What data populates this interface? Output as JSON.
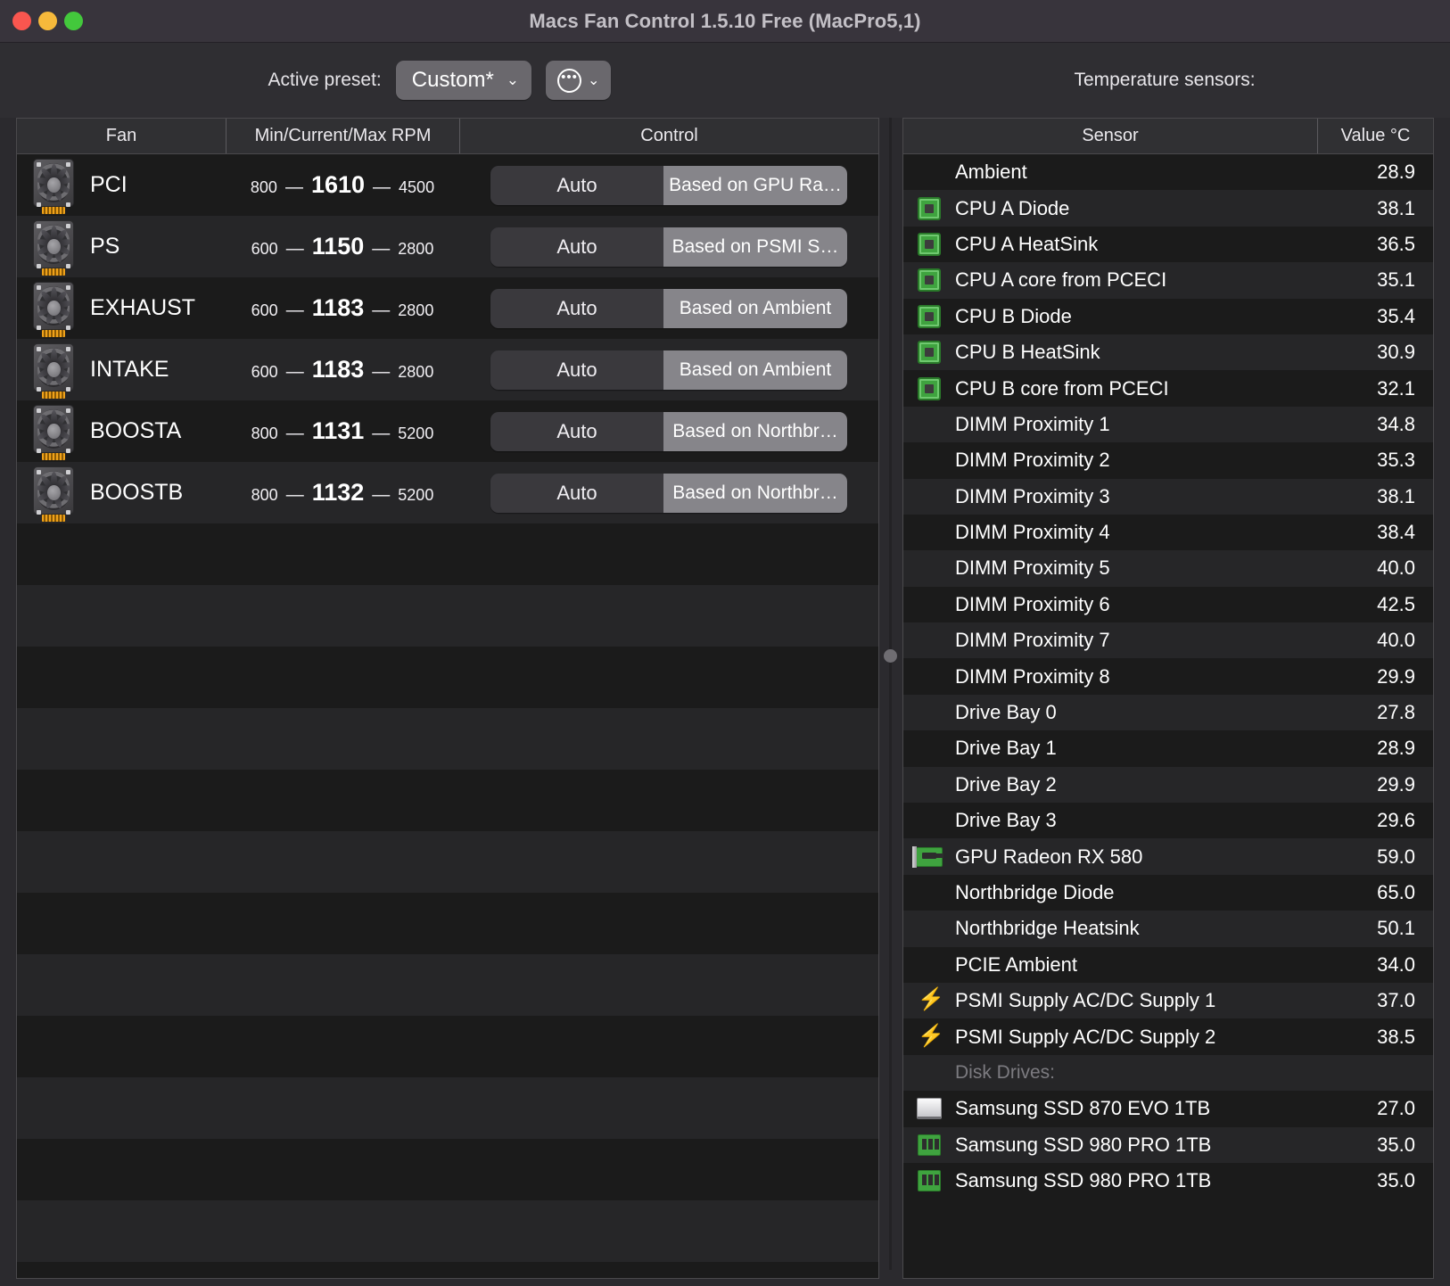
{
  "window": {
    "title": "Macs Fan Control 1.5.10 Free (MacPro5,1)",
    "traffic_lights": [
      "close-button",
      "minimize-button",
      "zoom-button"
    ]
  },
  "toolbar": {
    "preset_label": "Active preset:",
    "preset_value": "Custom*",
    "preset_chevron": "⌄",
    "menu_dots": "•••",
    "menu_chevron": "⌄",
    "sensors_title": "Temperature sensors:"
  },
  "fan_table": {
    "columns": [
      "Fan",
      "Min/Current/Max RPM",
      "Control"
    ],
    "rows": [
      {
        "name": "PCI",
        "min": "800",
        "current": "1610",
        "max": "4500",
        "auto": "Auto",
        "mode": "Based on GPU Ra…"
      },
      {
        "name": "PS",
        "min": "600",
        "current": "1150",
        "max": "2800",
        "auto": "Auto",
        "mode": "Based on PSMI S…"
      },
      {
        "name": "EXHAUST",
        "min": "600",
        "current": "1183",
        "max": "2800",
        "auto": "Auto",
        "mode": "Based on Ambient"
      },
      {
        "name": "INTAKE",
        "min": "600",
        "current": "1183",
        "max": "2800",
        "auto": "Auto",
        "mode": "Based on Ambient"
      },
      {
        "name": "BOOSTA",
        "min": "800",
        "current": "1131",
        "max": "5200",
        "auto": "Auto",
        "mode": "Based on Northbr…"
      },
      {
        "name": "BOOSTB",
        "min": "800",
        "current": "1132",
        "max": "5200",
        "auto": "Auto",
        "mode": "Based on Northbr…"
      }
    ],
    "empty_row_count": 12,
    "dash": "—"
  },
  "sensor_table": {
    "columns": [
      "Sensor",
      "Value °C"
    ],
    "rows": [
      {
        "icon": "",
        "name": "Ambient",
        "value": "28.9"
      },
      {
        "icon": "cpu-icon",
        "name": "CPU A Diode",
        "value": "38.1"
      },
      {
        "icon": "cpu-icon",
        "name": "CPU A HeatSink",
        "value": "36.5"
      },
      {
        "icon": "cpu-icon",
        "name": "CPU A core from PCECI",
        "value": "35.1"
      },
      {
        "icon": "cpu-icon",
        "name": "CPU B Diode",
        "value": "35.4"
      },
      {
        "icon": "cpu-icon",
        "name": "CPU B HeatSink",
        "value": "30.9"
      },
      {
        "icon": "cpu-icon",
        "name": "CPU B core from PCECI",
        "value": "32.1"
      },
      {
        "icon": "",
        "name": "DIMM Proximity 1",
        "value": "34.8"
      },
      {
        "icon": "",
        "name": "DIMM Proximity 2",
        "value": "35.3"
      },
      {
        "icon": "",
        "name": "DIMM Proximity 3",
        "value": "38.1"
      },
      {
        "icon": "",
        "name": "DIMM Proximity 4",
        "value": "38.4"
      },
      {
        "icon": "",
        "name": "DIMM Proximity 5",
        "value": "40.0"
      },
      {
        "icon": "",
        "name": "DIMM Proximity 6",
        "value": "42.5"
      },
      {
        "icon": "",
        "name": "DIMM Proximity 7",
        "value": "40.0"
      },
      {
        "icon": "",
        "name": "DIMM Proximity 8",
        "value": "29.9"
      },
      {
        "icon": "",
        "name": "Drive Bay 0",
        "value": "27.8"
      },
      {
        "icon": "",
        "name": "Drive Bay 1",
        "value": "28.9"
      },
      {
        "icon": "",
        "name": "Drive Bay 2",
        "value": "29.9"
      },
      {
        "icon": "",
        "name": "Drive Bay 3",
        "value": "29.6"
      },
      {
        "icon": "gpu-icon",
        "name": "GPU Radeon RX 580",
        "value": "59.0"
      },
      {
        "icon": "",
        "name": "Northbridge Diode",
        "value": "65.0"
      },
      {
        "icon": "",
        "name": "Northbridge Heatsink",
        "value": "50.1"
      },
      {
        "icon": "",
        "name": "PCIE Ambient",
        "value": "34.0"
      },
      {
        "icon": "bolt-icon",
        "name": "PSMI Supply AC/DC Supply 1",
        "value": "37.0"
      },
      {
        "icon": "bolt-icon",
        "name": "PSMI Supply AC/DC Supply 2",
        "value": "38.5"
      },
      {
        "icon": "",
        "name": "Disk Drives:",
        "value": "",
        "group": true
      },
      {
        "icon": "ssd-icon",
        "name": "Samsung SSD 870 EVO 1TB",
        "value": "27.0"
      },
      {
        "icon": "nvme-icon",
        "name": "Samsung SSD 980 PRO 1TB",
        "value": "35.0"
      },
      {
        "icon": "nvme-icon",
        "name": "Samsung SSD 980 PRO 1TB",
        "value": "35.0"
      }
    ]
  },
  "colors": {
    "window_bg": "#2b2a2e",
    "titlebar_bg": "#38343c",
    "table_bg": "#1b1b1b",
    "row_alt_bg": "#262628",
    "header_bg": "#303033",
    "accent_selected": "#86858a",
    "cpu_green": "#3fa33f",
    "bolt_yellow": "#f5c518"
  }
}
